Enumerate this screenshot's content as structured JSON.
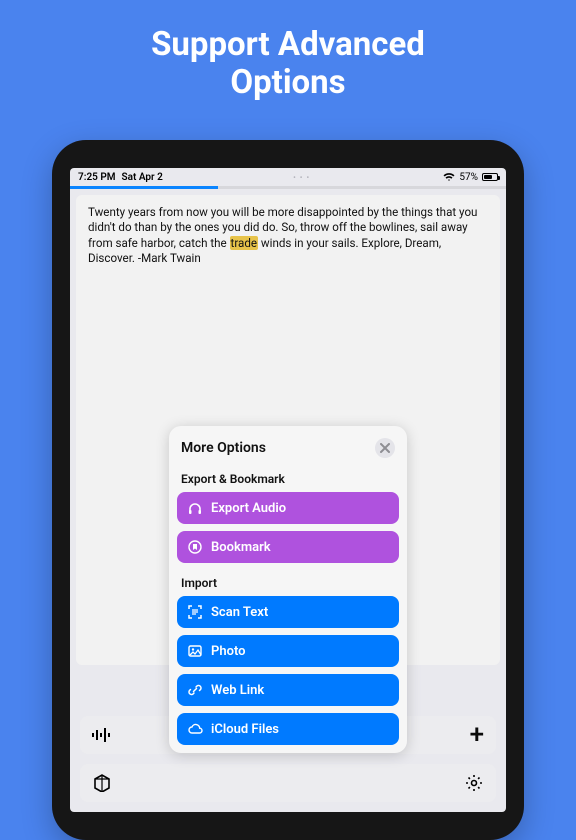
{
  "headline": {
    "line1": "Support Advanced",
    "line2": "Options"
  },
  "status": {
    "time": "7:25 PM",
    "date": "Sat Apr 2",
    "battery_pct": "57%"
  },
  "reader": {
    "text_before": "Twenty years from now you will be more disappointed by the things that you didn't do than by the ones you did do. So, throw off the bowlines, sail away from safe harbor, catch the ",
    "highlight": "trade",
    "text_after": " winds in your sails. Explore, Dream, Discover. -Mark Twain"
  },
  "popover": {
    "title": "More Options",
    "sections": {
      "export": {
        "title": "Export & Bookmark",
        "items": [
          {
            "label": "Export Audio"
          },
          {
            "label": "Bookmark"
          }
        ]
      },
      "import": {
        "title": "Import",
        "items": [
          {
            "label": "Scan Text"
          },
          {
            "label": "Photo"
          },
          {
            "label": "Web Link"
          },
          {
            "label": "iCloud Files"
          }
        ]
      }
    }
  }
}
